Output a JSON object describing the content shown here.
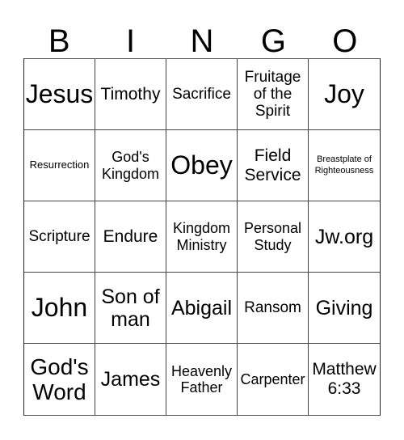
{
  "card": {
    "header": [
      "B",
      "I",
      "N",
      "G",
      "O"
    ],
    "rows": [
      [
        "Jesus",
        "Timothy",
        "Sacrifice",
        "Fruitage of the Spirit",
        "Joy"
      ],
      [
        "Resurrection",
        "God's Kingdom",
        "Obey",
        "Field Service",
        "Breastplate of Righteousness"
      ],
      [
        "Scripture",
        "Endure",
        "Kingdom Ministry",
        "Personal Study",
        "Jw.org"
      ],
      [
        "John",
        "Son of man",
        "Abigail",
        "Ransom",
        "Giving"
      ],
      [
        "God's Word",
        "James",
        "Heavenly Father",
        "Carpenter",
        "Matthew 6:33"
      ]
    ]
  }
}
